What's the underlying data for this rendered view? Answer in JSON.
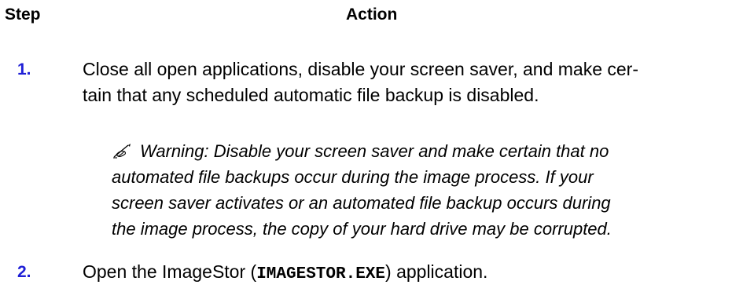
{
  "header": {
    "step_label": "Step",
    "action_label": "Action"
  },
  "steps": [
    {
      "number": "1.",
      "text_line1": "Close all open applications, disable your screen saver, and make cer-",
      "text_line2": "tain that any scheduled automatic file backup is disabled."
    },
    {
      "number": "2.",
      "text_before": "Open the ImageStor (",
      "code": "IMAGESTOR.EXE",
      "text_after": ") application."
    }
  ],
  "warning": {
    "icon": "writing-hand-icon",
    "line1": "Warning: Disable your screen saver and make certain that no",
    "line2": "automated file backups occur during the image process. If your",
    "line3": "screen saver activates or an automated file backup occurs during",
    "line4": "the image process, the copy of your hard drive may be corrupted."
  },
  "colors": {
    "step_number": "#1f1fd6",
    "text": "#000000"
  }
}
